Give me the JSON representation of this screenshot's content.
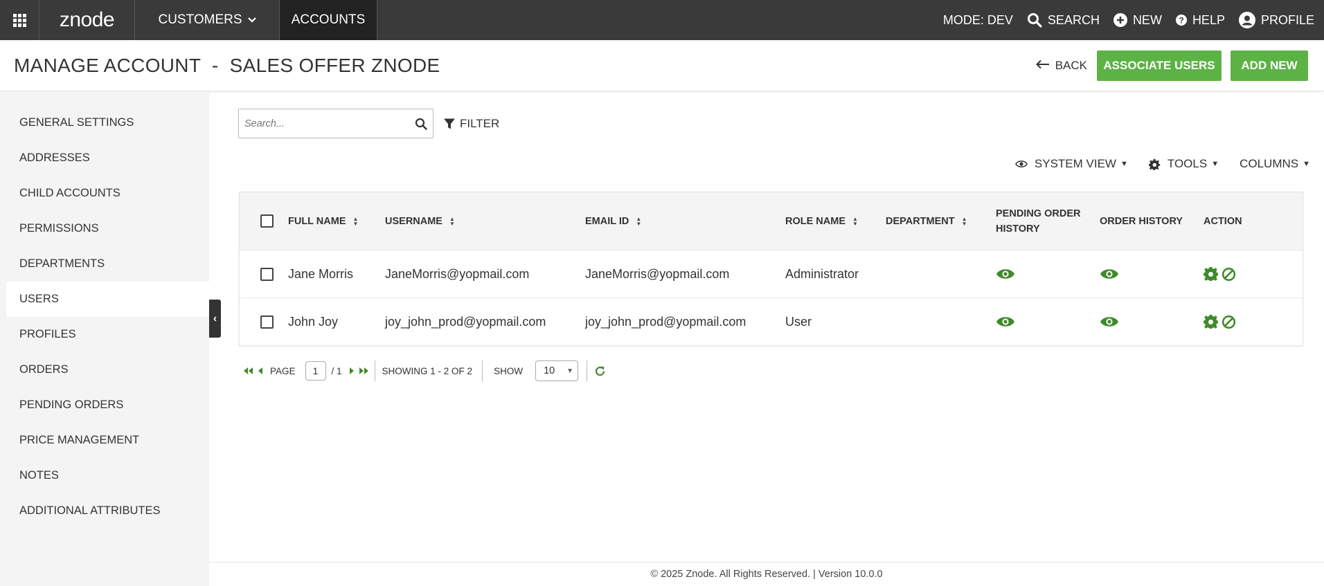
{
  "topnav": {
    "logo": "znode",
    "customers": "CUSTOMERS",
    "accounts": "ACCOUNTS",
    "mode": "MODE: DEV",
    "search": "SEARCH",
    "new": "NEW",
    "help": "HELP",
    "profile": "PROFILE"
  },
  "header": {
    "title": "MANAGE ACCOUNT  -  SALES OFFER ZNODE",
    "back": "BACK",
    "associate_users": "ASSOCIATE USERS",
    "add_new": "ADD NEW"
  },
  "sidebar": {
    "items": [
      {
        "label": "GENERAL SETTINGS"
      },
      {
        "label": "ADDRESSES"
      },
      {
        "label": "CHILD ACCOUNTS"
      },
      {
        "label": "PERMISSIONS"
      },
      {
        "label": "DEPARTMENTS"
      },
      {
        "label": "USERS"
      },
      {
        "label": "PROFILES"
      },
      {
        "label": "ORDERS"
      },
      {
        "label": "PENDING ORDERS"
      },
      {
        "label": "PRICE MANAGEMENT"
      },
      {
        "label": "NOTES"
      },
      {
        "label": "ADDITIONAL ATTRIBUTES"
      }
    ],
    "active_index": 5
  },
  "search": {
    "placeholder": "Search..."
  },
  "filter": {
    "label": "FILTER"
  },
  "toolbar": {
    "system_view": "SYSTEM VIEW",
    "tools": "TOOLS",
    "columns": "COLUMNS"
  },
  "grid": {
    "headers": {
      "full_name": "FULL NAME",
      "username": "USERNAME",
      "email": "EMAIL ID",
      "role": "ROLE NAME",
      "department": "DEPARTMENT",
      "pending_line1": "PENDING ORDER",
      "pending_line2": "HISTORY",
      "order_history": "ORDER HISTORY",
      "action": "ACTION"
    },
    "rows": [
      {
        "full_name": "Jane Morris",
        "username": "JaneMorris@yopmail.com",
        "email": "JaneMorris@yopmail.com",
        "role": "Administrator",
        "department": ""
      },
      {
        "full_name": "John Joy",
        "username": "joy_john_prod@yopmail.com",
        "email": "joy_john_prod@yopmail.com",
        "role": "User",
        "department": ""
      }
    ]
  },
  "pager": {
    "page_label": "PAGE",
    "current_page": "1",
    "total": "/ 1",
    "showing": "SHOWING 1 - 2 OF 2",
    "show_label": "SHOW",
    "page_size": "10"
  },
  "footer": {
    "text": "© 2025 Znode. All Rights Reserved. | Version 10.0.0"
  },
  "colors": {
    "accent": "#5db246",
    "navbar": "#3a3a3a",
    "icon_green": "#3f8a2a"
  }
}
